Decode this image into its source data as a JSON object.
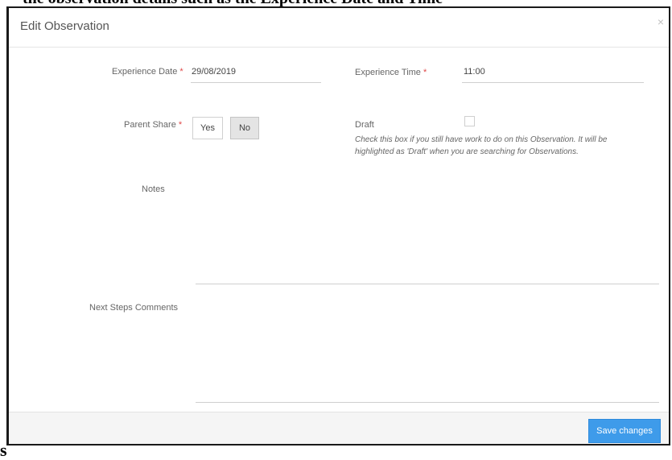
{
  "background": {
    "top_text": "the observation details such as the Experience Date and Time",
    "bottom_text": "s"
  },
  "modal": {
    "title": "Edit Observation",
    "close_glyph": "×"
  },
  "form": {
    "experience_date": {
      "label": "Experience Date",
      "required": "*",
      "value": "29/08/2019"
    },
    "experience_time": {
      "label": "Experience Time",
      "required": "*",
      "value": "11:00"
    },
    "parent_share": {
      "label": "Parent Share",
      "required": "*",
      "options": [
        "Yes",
        "No"
      ],
      "selected": "No"
    },
    "draft": {
      "label": "Draft",
      "checked": false,
      "help_line1": "Check this box if you still have work to do on this Observation. It will be",
      "help_line2": "highlighted as 'Draft' when you are searching for Observations."
    },
    "notes": {
      "label": "Notes",
      "value": ""
    },
    "next_steps": {
      "label": "Next Steps Comments",
      "value": ""
    }
  },
  "footer": {
    "save_label": "Save changes"
  },
  "colors": {
    "primary": "#3e9bea",
    "required": "#e04848"
  }
}
